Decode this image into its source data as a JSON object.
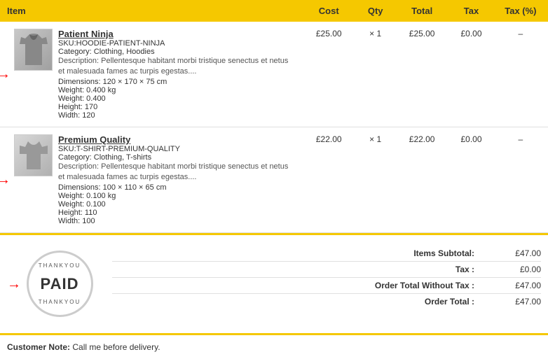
{
  "table": {
    "headers": {
      "item": "Item",
      "cost": "Cost",
      "qty": "Qty",
      "total": "Total",
      "tax": "Tax",
      "tax_pct": "Tax (%)"
    },
    "rows": [
      {
        "name": "Patient Ninja",
        "sku": "SKU:HOODIE-PATIENT-NINJA",
        "category": "Category: Clothing, Hoodies",
        "description": "Description: Pellentesque habitant morbi tristique senectus et netus et malesuada fames ac turpis egestas....",
        "dimensions": "Dimensions: 120 × 170 × 75 cm",
        "weight_line": "Weight: 0.400 kg",
        "weight": "Weight: 0.400",
        "height": "Height: 170",
        "width": "Width: 120",
        "cost": "£25.00",
        "qty": "× 1",
        "total": "£25.00",
        "tax": "£0.00",
        "tax_pct": "–",
        "type": "hoodie"
      },
      {
        "name": "Premium Quality",
        "sku": "SKU:T-SHIRT-PREMIUM-QUALITY",
        "category": "Category: Clothing, T-shirts",
        "description": "Description: Pellentesque habitant morbi tristique senectus et netus et malesuada fames ac turpis egestas....",
        "dimensions": "Dimensions: 100 × 110 × 65 cm",
        "weight_line": "Weight: 0.100 kg",
        "weight": "Weight: 0.100",
        "height": "Height: 110",
        "width": "Width: 100",
        "cost": "£22.00",
        "qty": "× 1",
        "total": "£22.00",
        "tax": "£0.00",
        "tax_pct": "–",
        "type": "tshirt"
      }
    ]
  },
  "summary": {
    "items_subtotal_label": "Items Subtotal:",
    "items_subtotal_value": "£47.00",
    "tax_label": "Tax :",
    "tax_value": "£0.00",
    "order_total_without_tax_label": "Order Total Without Tax :",
    "order_total_without_tax_value": "£47.00",
    "order_total_label": "Order Total :",
    "order_total_value": "£47.00"
  },
  "paid_stamp": {
    "thankyou_top": "THANKYOU",
    "paid": "PAID",
    "thankyou_bottom": "THANKYOU"
  },
  "customer_note": {
    "label": "Customer Note:",
    "text": "Call me before delivery."
  }
}
